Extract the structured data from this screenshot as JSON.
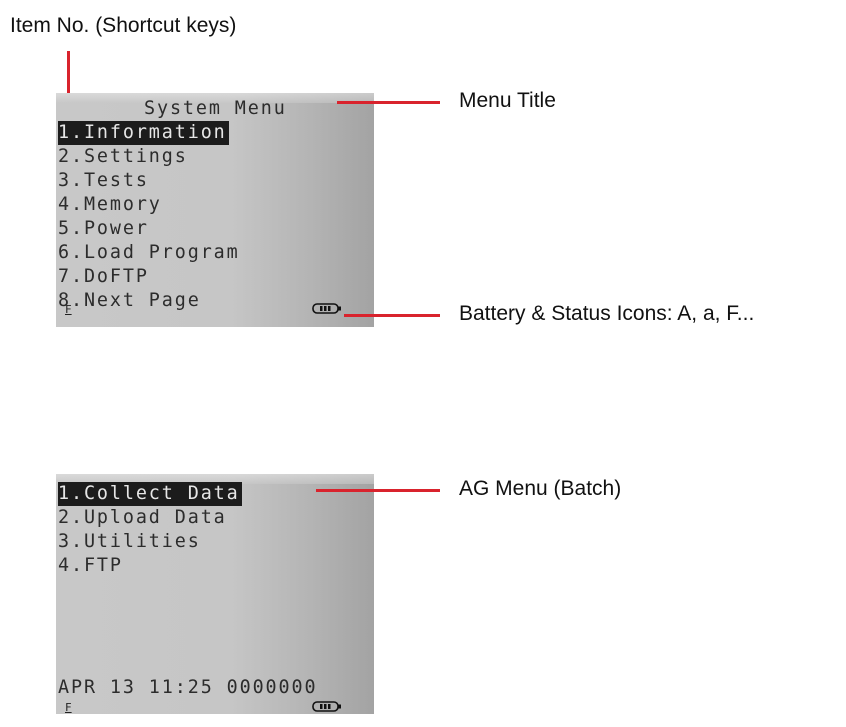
{
  "annotations": {
    "item_no": "Item No. (Shortcut keys)",
    "menu_title": "Menu Title",
    "battery_status": "Battery & Status Icons: A, a, F...",
    "ag_menu": "AG Menu (Batch)"
  },
  "system_menu": {
    "title": "System Menu",
    "items": [
      {
        "label": "1.Information",
        "selected": true
      },
      {
        "label": "2.Settings"
      },
      {
        "label": "3.Tests"
      },
      {
        "label": "4.Memory"
      },
      {
        "label": "5.Power"
      },
      {
        "label": "6.Load Program"
      },
      {
        "label": "7.DoFTP"
      },
      {
        "label": "8.Next Page"
      }
    ],
    "status_icon": "F",
    "battery_icon": "battery-icon"
  },
  "ag_menu": {
    "items": [
      {
        "label": "1.Collect Data",
        "selected": true
      },
      {
        "label": "2.Upload Data"
      },
      {
        "label": "3.Utilities"
      },
      {
        "label": "4.FTP"
      }
    ],
    "status_line": "APR 13 11:25 0000000",
    "status_icon": "F",
    "battery_icon": "battery-icon"
  },
  "colors": {
    "callout_line": "#d9232d",
    "lcd_background": "#c6c6c6",
    "lcd_text": "#2c2c2c",
    "selection": "#1c1c1c"
  }
}
